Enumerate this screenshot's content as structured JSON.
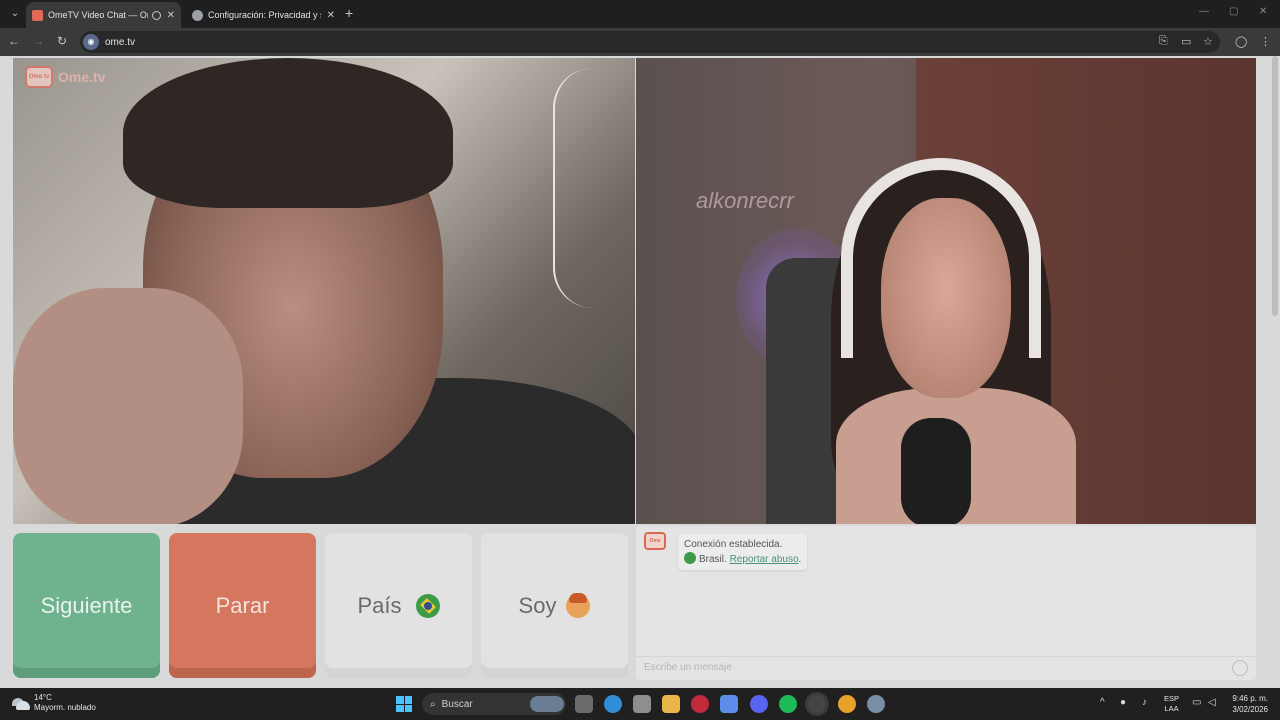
{
  "browser": {
    "tabs": [
      {
        "title": "OmeTV Video Chat — Ome",
        "active": true
      },
      {
        "title": "Configuración: Privacidad y seg",
        "active": false
      }
    ],
    "url": "ome.tv"
  },
  "video": {
    "logo_text": "Ome.tv",
    "logo_tv_label": "Ome tv",
    "neon_sign_text": "alkonrecrr"
  },
  "controls": {
    "next_label": "Siguiente",
    "stop_label": "Parar",
    "country_label": "País",
    "gender_label": "Soy"
  },
  "chat": {
    "status": "Conexión establecida.",
    "country": "Brasil.",
    "report_link": "Reportar abuso",
    "input_placeholder": "Escribe un mensaje"
  },
  "taskbar": {
    "temperature": "14°C",
    "weather": "Mayorm. nublado",
    "search_label": "Buscar",
    "lang_primary": "ESP",
    "lang_secondary": "LAA",
    "time": "9:46 p. m.",
    "date": "3/02/2026"
  },
  "colors": {
    "next_button": "#6fb38e",
    "stop_button": "#d4775e",
    "accent_link": "#4c8f7a"
  }
}
